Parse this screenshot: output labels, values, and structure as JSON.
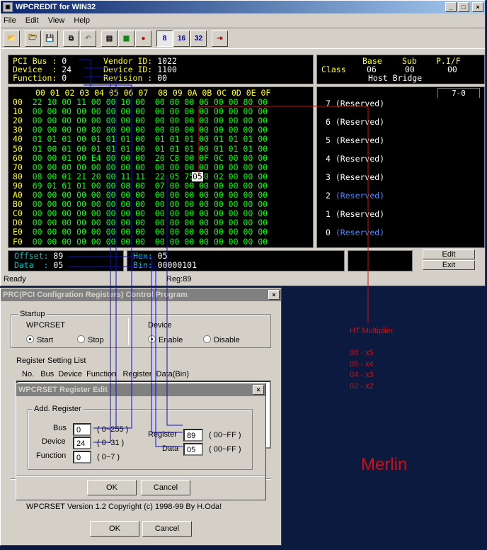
{
  "main": {
    "title": "WPCREDIT for WIN32",
    "menu": [
      "File",
      "Edit",
      "View",
      "Help"
    ],
    "toolbar_labels": [
      "8",
      "16",
      "32"
    ],
    "pci": {
      "bus_label": "PCI Bus :",
      "bus": "0",
      "device_label": "Device  :",
      "device": "24",
      "function_label": "Function:",
      "function": "0",
      "vendor_label": "Vendor ID:",
      "vendor": "1022",
      "devid_label": "Device ID:",
      "devid": "1100",
      "rev_label": "Revision :",
      "rev": "00"
    },
    "class": {
      "label": "Class",
      "base_h": "Base",
      "sub_h": "Sub",
      "pif_h": "P.I/F",
      "base": "06",
      "sub": "00",
      "pif": "00",
      "desc": "Host Bridge"
    },
    "grid_header": "00 01 02 03 04 05 06 07  08 09 0A 0B 0C 0D 0E 0F",
    "rows": [
      {
        "addr": "00",
        "data": "22 10 00 11 00 00 10 00  00 00 00 06 00 00 80 00"
      },
      {
        "addr": "10",
        "data": "00 00 00 00 00 00 00 00  00 00 00 00 00 00 00 00"
      },
      {
        "addr": "20",
        "data": "00 00 00 00 00 00 00 00  00 00 00 00 00 00 00 00"
      },
      {
        "addr": "30",
        "data": "00 00 00 00 80 00 00 00  00 00 00 00 00 00 00 00"
      },
      {
        "addr": "40",
        "data": "01 01 01 00 01 01 01 00  01 01 01 00 01 01 01 00"
      },
      {
        "addr": "50",
        "data": "01 00 01 00 01 01 01 00  01 01 01 00 01 01 01 00"
      },
      {
        "addr": "60",
        "data": "00 00 01 00 E4 00 00 00  20 C8 00 0F 0C 00 00 00"
      },
      {
        "addr": "70",
        "data": "00 00 00 00 00 00 00 00  00 00 00 00 00 00 00 00"
      },
      {
        "addr": "80",
        "data": "08 00 01 21 20 00 11 11  22 05 75 80 02 00 00 00"
      },
      {
        "addr": "90",
        "data": "69 01 61 01 00 00 08 00  07 00 00 00 00 00 00 00"
      },
      {
        "addr": "A0",
        "data": "00 00 00 00 00 00 00 00  00 00 00 00 00 00 00 00"
      },
      {
        "addr": "B0",
        "data": "00 00 00 00 00 00 00 00  00 00 00 00 00 00 00 00"
      },
      {
        "addr": "C0",
        "data": "00 00 00 00 00 00 00 00  00 00 00 00 00 00 00 00"
      },
      {
        "addr": "D0",
        "data": "00 00 00 00 00 00 00 00  00 00 00 00 00 00 00 00"
      },
      {
        "addr": "E0",
        "data": "00 00 00 00 00 00 00 00  00 00 00 00 00 00 00 00"
      },
      {
        "addr": "F0",
        "data": "00 00 00 00 00 00 00 00  00 00 00 00 00 00 00 00"
      }
    ],
    "selected_cell": "05",
    "bits_tab": "7-0",
    "bits": [
      {
        "n": "7",
        "text": "(Reserved)",
        "color": "#ffffff"
      },
      {
        "n": "6",
        "text": "(Reserved)",
        "color": "#ffffff"
      },
      {
        "n": "5",
        "text": "(Reserved)",
        "color": "#ffffff"
      },
      {
        "n": "4",
        "text": "(Reserved)",
        "color": "#ffffff"
      },
      {
        "n": "3",
        "text": "(Reserved)",
        "color": "#ffffff"
      },
      {
        "n": "2",
        "text": "(Reserved)",
        "color": "#4b8bff"
      },
      {
        "n": "1",
        "text": "(Reserved)",
        "color": "#ffffff"
      },
      {
        "n": "0",
        "text": "(Reserved)",
        "color": "#4b8bff"
      }
    ],
    "offset_label": "Offset:",
    "offset": "89",
    "data_label": "Data  :",
    "data": "05",
    "hex_label": "Hex:",
    "hex": "05",
    "bin_label": "Bin:",
    "bin": "00000101",
    "edit_btn": "Edit",
    "exit_btn": "Exit",
    "status_left": "Ready",
    "status_mid": "Reg:89"
  },
  "prc": {
    "title": "PRC(PCI Configration Registers) Control Program",
    "startup_group": "Startup",
    "wpcrset_label": "WPCRSET",
    "start": "Start",
    "stop": "Stop",
    "device_label": "Device",
    "enable": "Enable",
    "disable": "Disable",
    "list_label": "Register Setting List",
    "list_header": "No.   Bus  Device  Function   Register  Data(Bin)",
    "footer": "WPCRSET  Version 1.2  Copyright (c) 1998-99  By H.Oda!",
    "ok": "OK",
    "cancel": "Cancel"
  },
  "edit": {
    "title": "WPCRSET Register Edit",
    "group": "Add. Register",
    "bus_label": "Bus",
    "bus": "0",
    "bus_range": "( 0~255 )",
    "device_label": "Device",
    "device": "24",
    "device_range": "( 0~31 )",
    "function_label": "Function",
    "function": "0",
    "function_range": "( 0~7 )",
    "register_label": "Register",
    "register": "89",
    "register_range": "( 00~FF )",
    "data_label": "Data",
    "data": "05",
    "data_range": "( 00~FF )",
    "ok": "OK",
    "cancel": "Cancel"
  },
  "annot": {
    "ht_title": "HT Multiplier",
    "ht_lines": [
      "06 - x5",
      "05 - x4",
      "04 - x3",
      "02 - x2"
    ],
    "merlin": "Merlin",
    "color_red": "#d01010",
    "color_blue": "#1010c0"
  }
}
